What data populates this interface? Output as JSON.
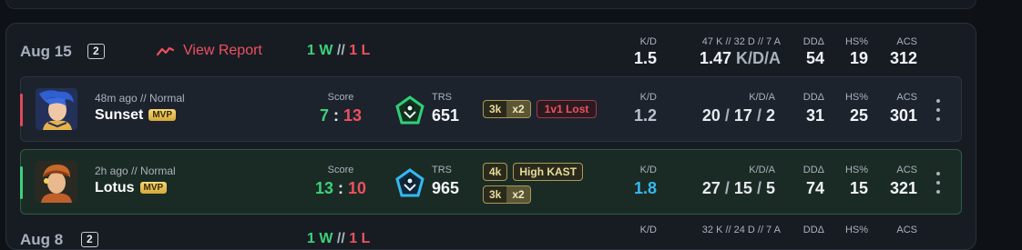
{
  "group1": {
    "date": "Aug 15",
    "count": "2",
    "report_label": "View Report",
    "wins": "1 W",
    "losses": "1 L",
    "wl_sep": "//",
    "kd_label": "K/D",
    "kd_value": "1.5",
    "kda_totals": "47 K // 32 D // 7 A",
    "kda_value": "1.47",
    "kda_unit": "K/D/A",
    "dd_label": "DDΔ",
    "dd_value": "54",
    "hs_label": "HS%",
    "hs_value": "19",
    "acs_label": "ACS",
    "acs_value": "312"
  },
  "matches": [
    {
      "ago": "48m ago // Normal",
      "agent": "Sunset",
      "badge": "MVP",
      "score_label": "Score",
      "score_own": "7",
      "score_sep": ":",
      "score_opp": "13",
      "trs_label": "TRS",
      "trs_value": "651",
      "tags": [
        {
          "text": "3k",
          "mult": "x2"
        },
        {
          "text": "1v1 Lost"
        }
      ],
      "kd_label": "K/D",
      "kd_value": "1.2",
      "kda_label": "K/D/A",
      "kills": "20",
      "deaths": "17",
      "assists": "2",
      "slash": "/",
      "dd_label": "DDΔ",
      "dd_value": "31",
      "hs_label": "HS%",
      "hs_value": "25",
      "acs_label": "ACS",
      "acs_value": "301",
      "result": "loss",
      "accent": "#e04a5a"
    },
    {
      "ago": "2h ago // Normal",
      "agent": "Lotus",
      "badge": "MVP",
      "score_label": "Score",
      "score_own": "13",
      "score_sep": ":",
      "score_opp": "10",
      "trs_label": "TRS",
      "trs_value": "965",
      "tags": [
        {
          "text": "4k"
        },
        {
          "text": "High KAST"
        },
        {
          "text": "3k",
          "mult": "x2"
        }
      ],
      "kd_label": "K/D",
      "kd_value": "1.8",
      "kda_label": "K/D/A",
      "kills": "27",
      "deaths": "15",
      "assists": "5",
      "slash": "/",
      "dd_label": "DDΔ",
      "dd_value": "74",
      "hs_label": "HS%",
      "hs_value": "15",
      "acs_label": "ACS",
      "acs_value": "321",
      "result": "win",
      "accent": "#3fd07a"
    }
  ],
  "group2": {
    "date": "Aug 8",
    "count": "2",
    "wins": "1 W",
    "losses": "1 L",
    "wl_sep": "//",
    "kd_label": "K/D",
    "kda_totals": "32 K // 24 D // 7 A",
    "dd_label": "DDΔ",
    "hs_label": "HS%",
    "acs_label": "ACS"
  },
  "colors": {
    "win": "#3fd07a",
    "loss": "#f0505f",
    "kd_neutral": "#b9c4d0",
    "kd_good": "#35b9f0"
  }
}
